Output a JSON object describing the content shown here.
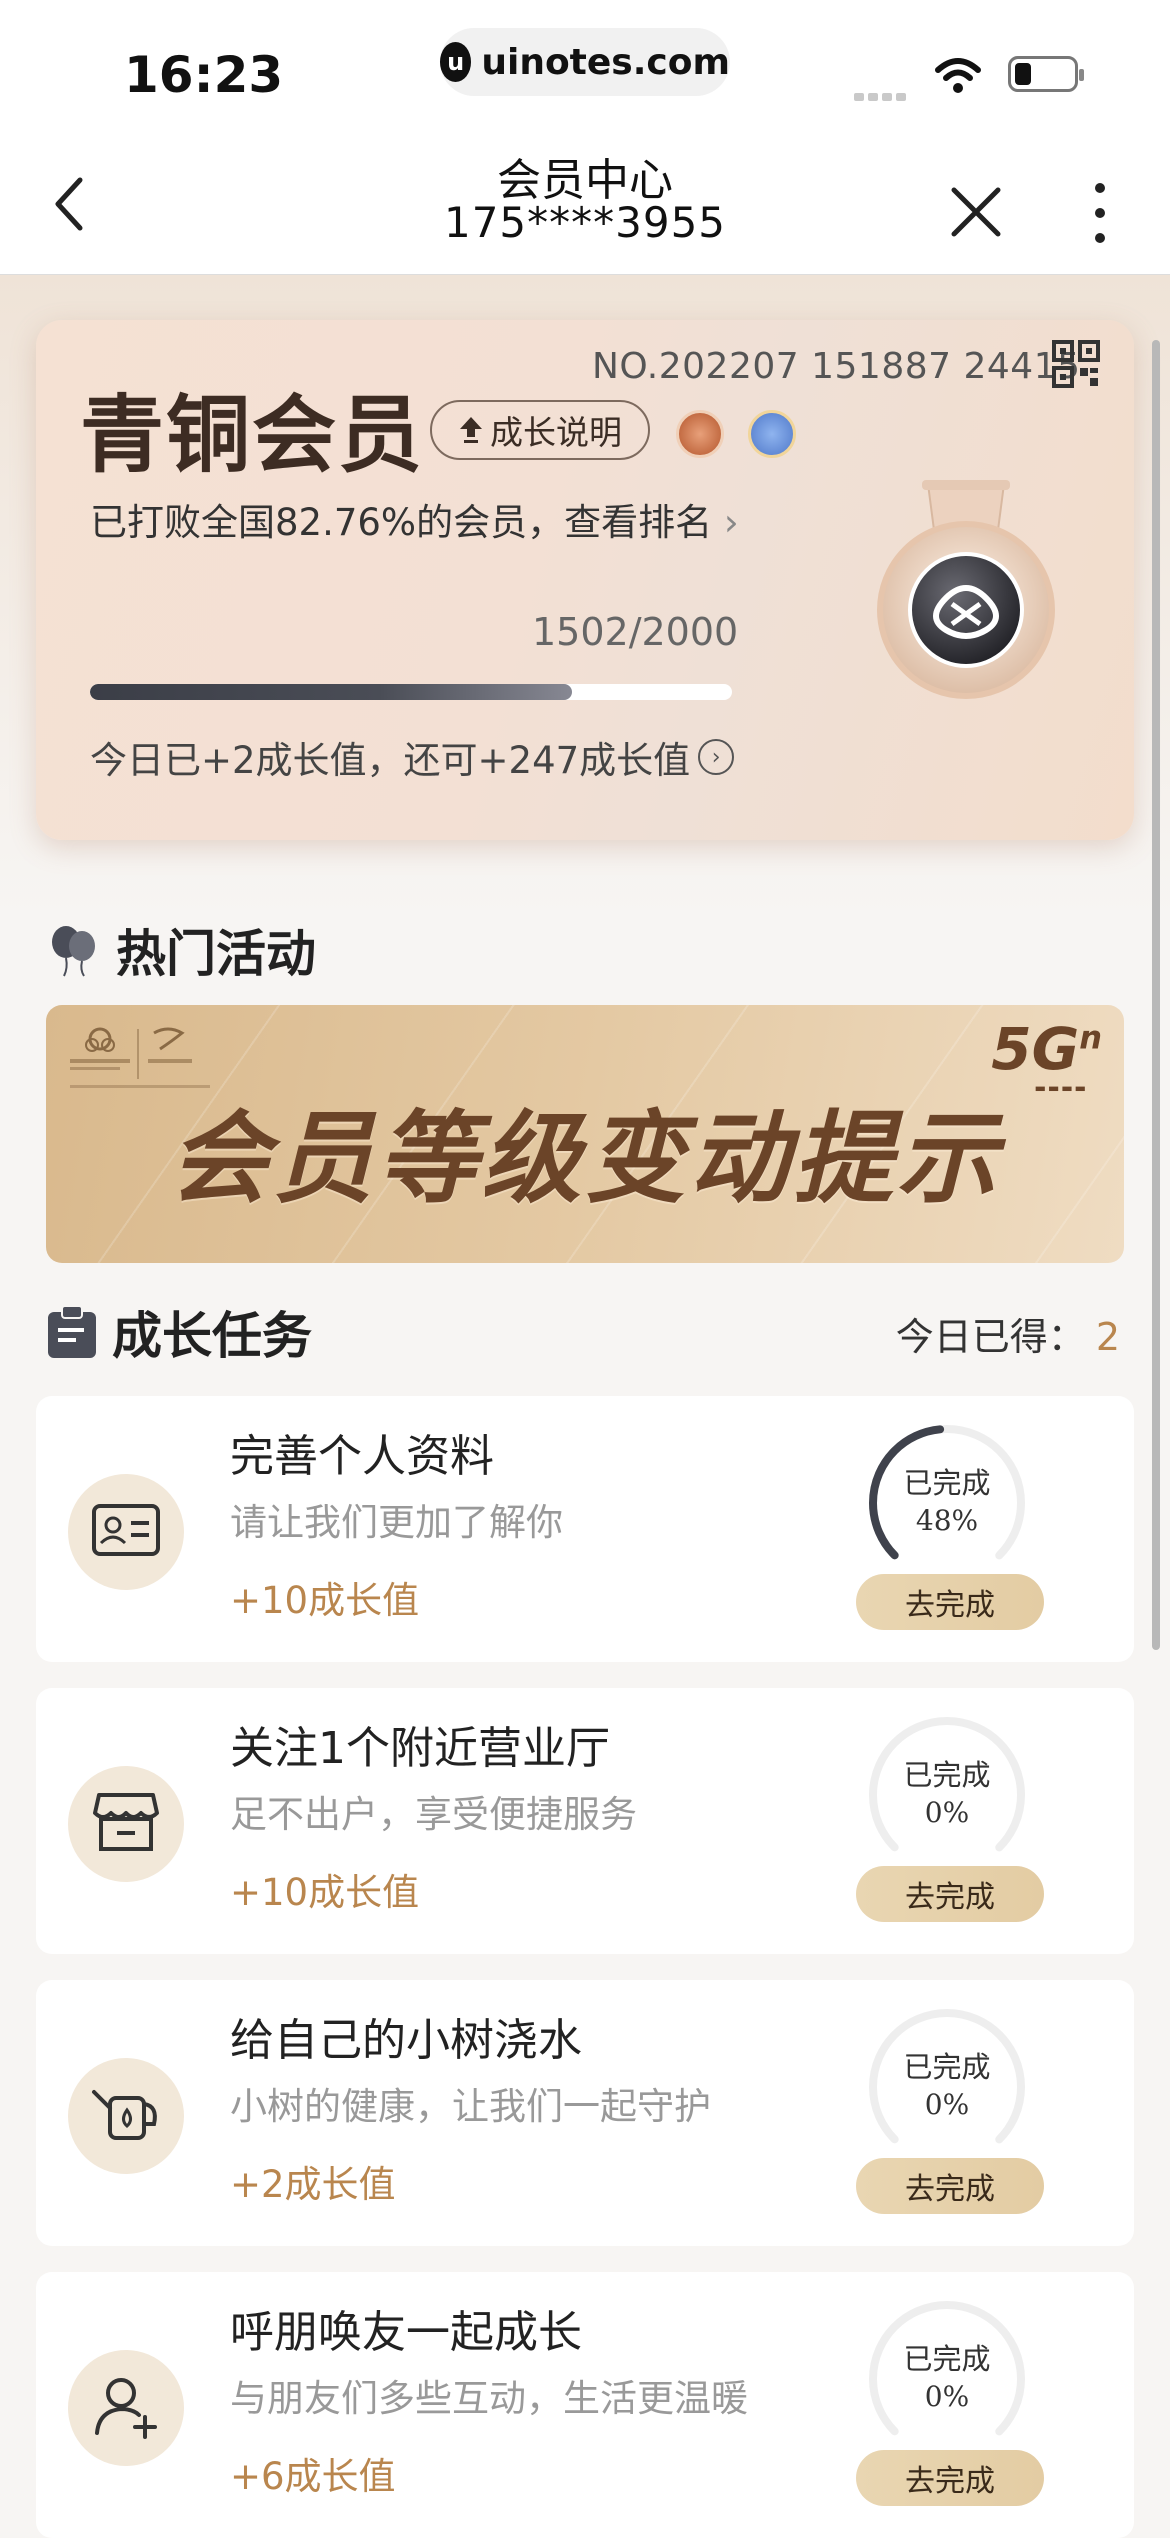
{
  "status": {
    "time": "16:23",
    "url": "uinotes.com"
  },
  "nav": {
    "title": "会员中心",
    "subtitle": "175****3955"
  },
  "card": {
    "member_no": "NO.202207 151887 24415",
    "level": "青铜会员",
    "explain": "成长说明",
    "rank_text": "已打败全国82.76%的会员，查看排名",
    "progress_text": "1502/2000",
    "progress_fraction": 0.751,
    "today_text": "今日已+2成长值，还可+247成长值"
  },
  "hot": {
    "title": "热门活动",
    "banner_text": "会员等级变动提示",
    "banner_5g": "5G",
    "banner_5g_sup": "n"
  },
  "growth": {
    "title": "成长任务",
    "today_label": "今日已得：",
    "today_value": "2",
    "tasks": [
      {
        "name": "完善个人资料",
        "desc": "请让我们更加了解你",
        "points": "+10成长值",
        "done_label": "已完成",
        "percent": "48%",
        "percent_value": 48,
        "button": "去完成",
        "icon": "id-card-icon"
      },
      {
        "name": "关注1个附近营业厅",
        "desc": "足不出户，享受便捷服务",
        "points": "+10成长值",
        "done_label": "已完成",
        "percent": "0%",
        "percent_value": 0,
        "button": "去完成",
        "icon": "store-icon"
      },
      {
        "name": "给自己的小树浇水",
        "desc": "小树的健康，让我们一起守护",
        "points": "+2成长值",
        "done_label": "已完成",
        "percent": "0%",
        "percent_value": 0,
        "button": "去完成",
        "icon": "watering-can-icon"
      },
      {
        "name": "呼朋唤友一起成长",
        "desc": "与朋友们多些互动，生活更温暖",
        "points": "+6成长值",
        "done_label": "已完成",
        "percent": "0%",
        "percent_value": 0,
        "button": "去完成",
        "icon": "add-friend-icon"
      }
    ]
  }
}
